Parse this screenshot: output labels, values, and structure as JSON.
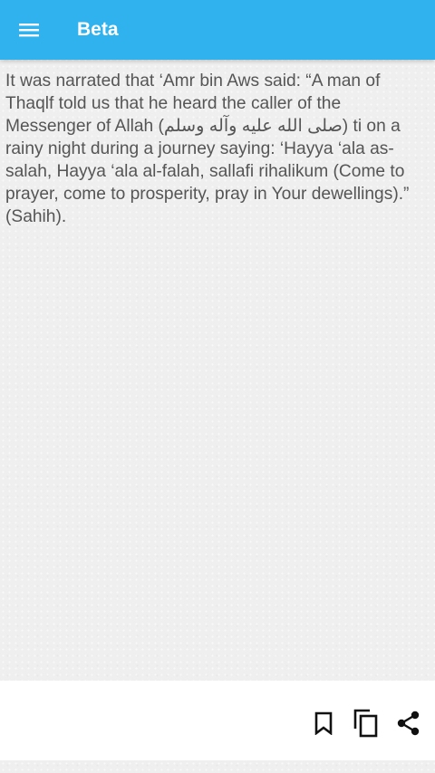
{
  "app_bar": {
    "title": "Beta",
    "menu_icon": "hamburger-menu-icon",
    "color": "#2fb2ee"
  },
  "hadith": {
    "text": "It was narrated that ‘Amr bin Aws said: “A man of Thaqlf told us that he heard the caller of the Messenger of Allah (صلى الله عليه وآله وسلم) ti on a rainy night during a journey saying: ‘Hayya ‘ala as-salah, Hayya ‘ala al-falah, sallafi rihalikum (Come to prayer, come to prosperity, pray in Your dewellings).” (Sahih)."
  },
  "actions": {
    "bookmark_icon": "bookmark-icon",
    "copy_icon": "copy-icon",
    "share_icon": "share-icon"
  }
}
